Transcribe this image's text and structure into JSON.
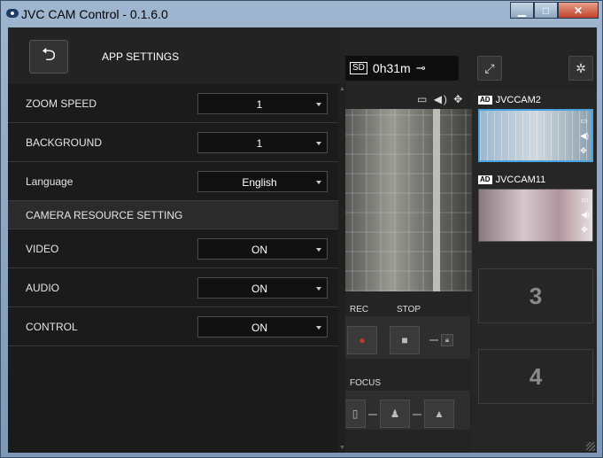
{
  "window": {
    "title": "JVC CAM Control - 0.1.6.0",
    "min_icon": "minimize-icon",
    "max_icon": "maximize-icon",
    "close_icon": "close-icon"
  },
  "status": {
    "sd": "SD",
    "time": "0h31m",
    "power_icon": "plug-icon"
  },
  "settings": {
    "title": "APP SETTINGS",
    "rows": [
      {
        "label": "ZOOM SPEED",
        "value": "1"
      },
      {
        "label": "BACKGROUND",
        "value": "1"
      },
      {
        "label": "Language",
        "value": "English"
      }
    ],
    "section": "CAMERA RESOURCE SETTING",
    "resource_rows": [
      {
        "label": "VIDEO",
        "value": "ON"
      },
      {
        "label": "AUDIO",
        "value": "ON"
      },
      {
        "label": "CONTROL",
        "value": "ON"
      }
    ]
  },
  "cameras": [
    {
      "badge": "AD",
      "name": "JVCCAM2",
      "active": true
    },
    {
      "badge": "AD",
      "name": "JVCCAM11",
      "active": false
    }
  ],
  "slots": [
    "3",
    "4"
  ],
  "controls": {
    "rec": "REC",
    "stop": "STOP",
    "focus": "FOCUS"
  },
  "colors": {
    "accent": "#4aa3df",
    "panel": "#1b1b1b"
  }
}
